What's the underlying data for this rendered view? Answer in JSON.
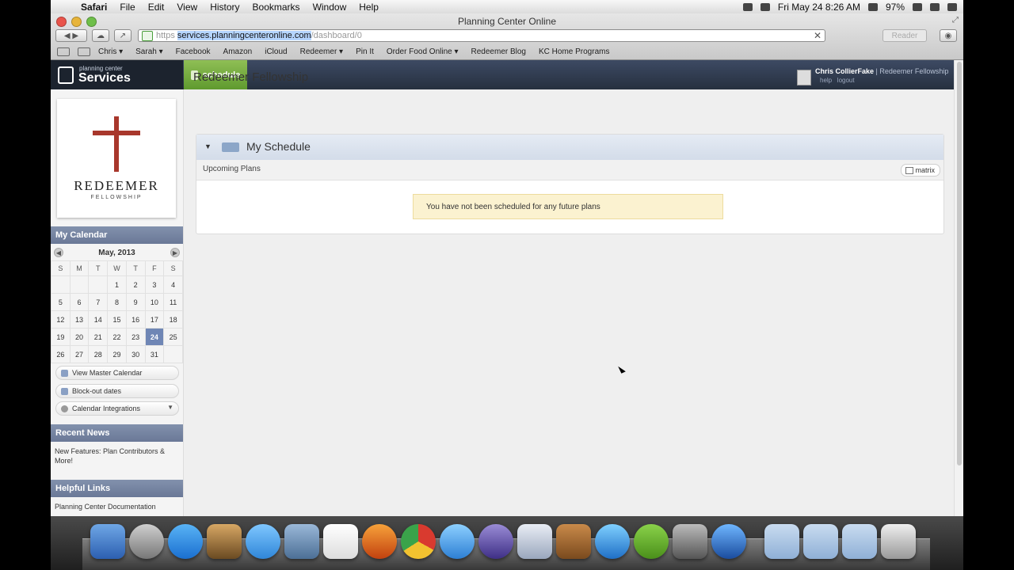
{
  "menubar": {
    "app": "Safari",
    "menus": [
      "File",
      "Edit",
      "View",
      "History",
      "Bookmarks",
      "Window",
      "Help"
    ],
    "clock": "Fri May 24  8:26 AM",
    "battery": "97%"
  },
  "window": {
    "title": "Planning Center Online",
    "url_scheme": "https",
    "url_host": "services.planningcenteronline.com",
    "url_path": "/dashboard/0",
    "reader_label": "Reader"
  },
  "bookmarks": [
    {
      "label": "Chris ▾"
    },
    {
      "label": "Sarah ▾"
    },
    {
      "label": "Facebook"
    },
    {
      "label": "Amazon"
    },
    {
      "label": "iCloud"
    },
    {
      "label": "Redeemer ▾"
    },
    {
      "label": "Pin It"
    },
    {
      "label": "Order Food Online ▾"
    },
    {
      "label": "Redeemer Blog"
    },
    {
      "label": "KC Home Programs"
    }
  ],
  "app": {
    "logo_small": "planning center",
    "logo_big": "Services",
    "tab_schedule": "schedule",
    "user_name": "Chris CollierFake",
    "user_org": "| Redeemer Fellowship",
    "help": "help",
    "logout": "logout"
  },
  "sidebar": {
    "org_name": "REDEEMER",
    "org_sub": "FELLOWSHIP",
    "calendar_title": "My Calendar",
    "month": "May, 2013",
    "weekdays": [
      "S",
      "M",
      "T",
      "W",
      "T",
      "F",
      "S"
    ],
    "weeks": [
      [
        "",
        "",
        "",
        "1",
        "2",
        "3",
        "4"
      ],
      [
        "5",
        "6",
        "7",
        "8",
        "9",
        "10",
        "11"
      ],
      [
        "12",
        "13",
        "14",
        "15",
        "16",
        "17",
        "18"
      ],
      [
        "19",
        "20",
        "21",
        "22",
        "23",
        "24",
        "25"
      ],
      [
        "26",
        "27",
        "28",
        "29",
        "30",
        "31",
        ""
      ]
    ],
    "today": "24",
    "view_master_calendar": "View Master Calendar",
    "blockout_dates": "Block-out dates",
    "calendar_integrations": "Calendar Integrations",
    "recent_news_title": "Recent News",
    "news_item": "New Features: Plan Contributors & More!",
    "helpful_links_title": "Helpful Links",
    "helpful_link": "Planning Center Documentation"
  },
  "main": {
    "title": "Redeemer Fellowship",
    "panel_title": "My Schedule",
    "upcoming_label": "Upcoming Plans",
    "matrix_label": "matrix",
    "notice": "You have not been scheduled for any future plans"
  },
  "colors": {
    "header": "#2f3a4e",
    "tab_green": "#7aae42",
    "section_head": "#7483a2",
    "today": "#6f86b5",
    "notice_bg": "#fbf2d0"
  }
}
